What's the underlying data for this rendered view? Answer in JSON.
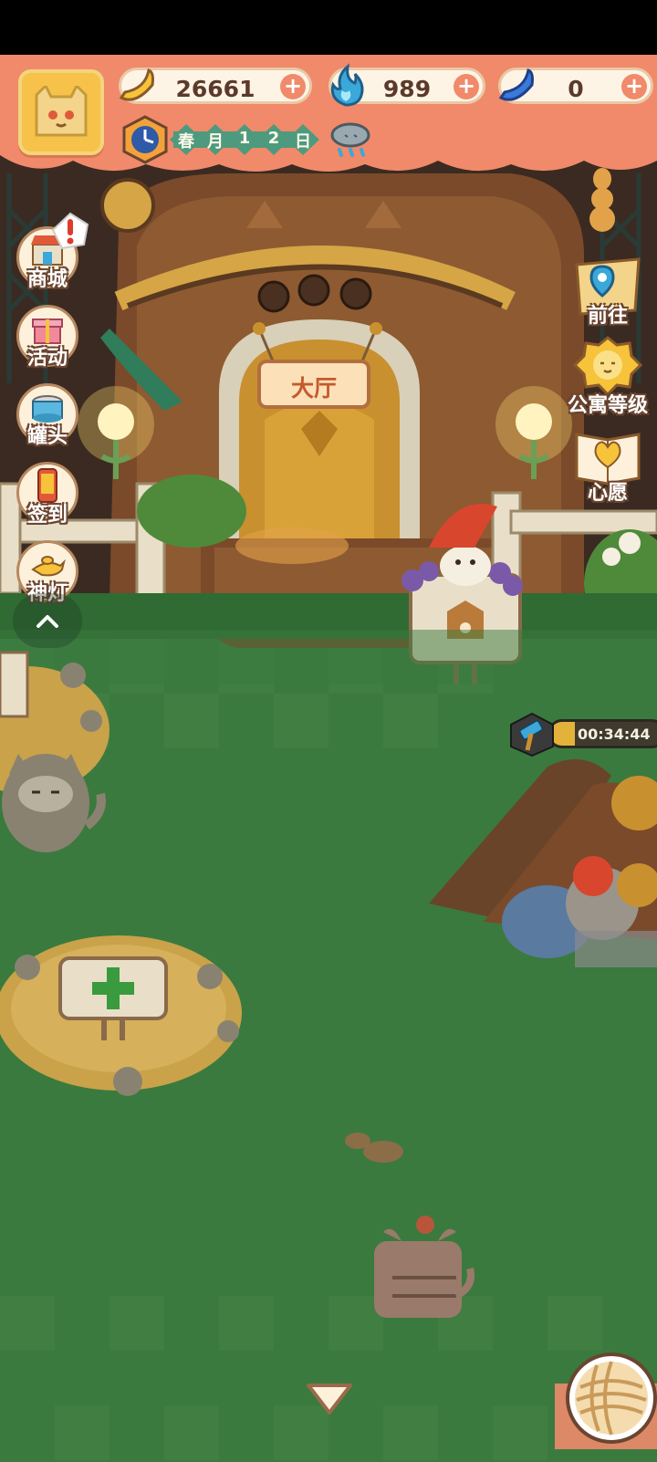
{
  "resources": {
    "bananas": {
      "value": "26661",
      "icon": "banana-icon"
    },
    "flames": {
      "value": "989",
      "icon": "blue-flame-icon"
    },
    "gems": {
      "value": "0",
      "icon": "blue-banana-icon"
    }
  },
  "calendar": {
    "season": "春",
    "month_label": "月",
    "day_tens": "1",
    "day_ones": "2",
    "day_label": "日",
    "weather_icon": "rain-cloud-icon"
  },
  "left_menu": [
    {
      "label": "商城",
      "icon": "shop-icon",
      "alert": true
    },
    {
      "label": "活动",
      "icon": "gift-icon"
    },
    {
      "label": "罐头",
      "icon": "can-icon"
    },
    {
      "label": "签到",
      "icon": "phone-checkin-icon"
    },
    {
      "label": "神灯",
      "icon": "magic-lamp-icon"
    }
  ],
  "right_menu": [
    {
      "label": "前往",
      "icon": "map-pin-icon"
    },
    {
      "label": "公寓等级",
      "icon": "sun-cat-icon"
    },
    {
      "label": "心愿",
      "icon": "heart-book-icon"
    }
  ],
  "scene": {
    "hall_sign": "大厅",
    "timer": "00:34:44",
    "timer_progress": 0.22
  },
  "colors": {
    "header": "#f08a6a",
    "grass": "#3b7a3f",
    "accent_green": "#4e9a7e"
  }
}
